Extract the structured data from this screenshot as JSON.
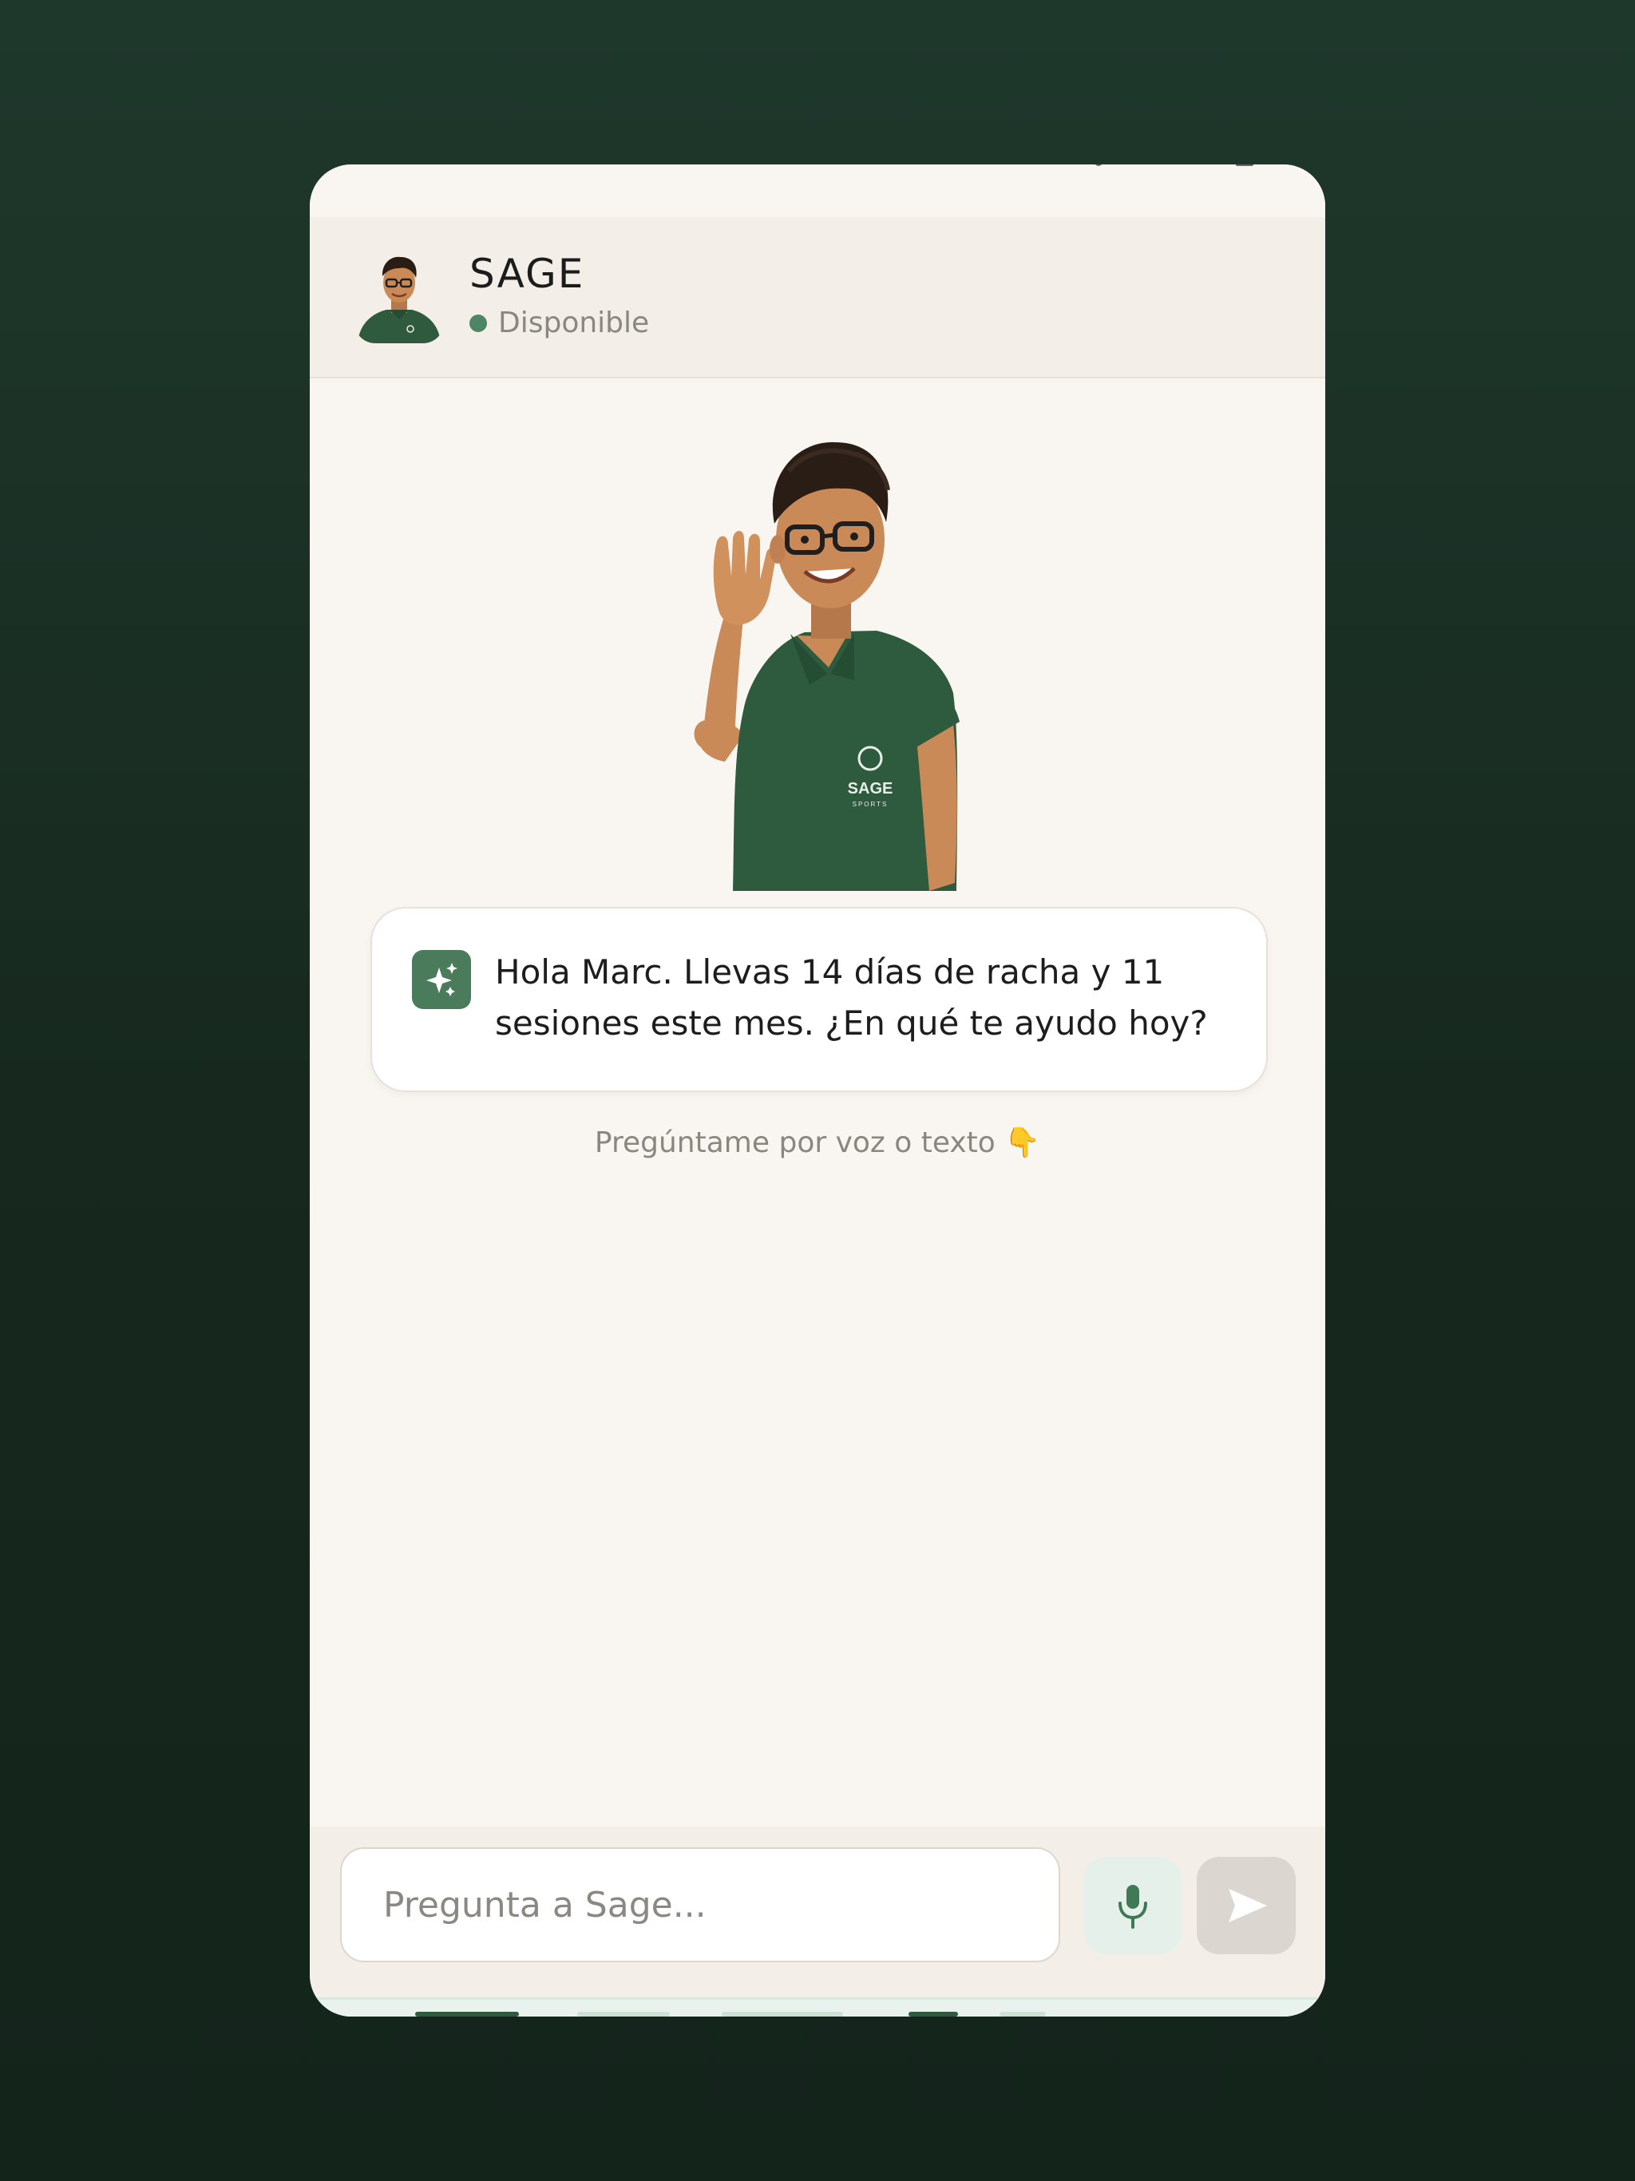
{
  "app": {
    "name": "SAGE",
    "status": "Disponible",
    "status_color": "#4e8663",
    "accent": "#4a7c5b"
  },
  "mascot": {
    "shirt_logo": "SAGE",
    "shirt_logo_sub": "SPORTS"
  },
  "message": {
    "icon": "sparkles-icon",
    "text": "Hola Marc. Llevas 14 días de racha y 11 sesiones este mes. ¿En qué te ayudo hoy?"
  },
  "hint": "Pregúntame por voz o texto 👇",
  "composer": {
    "placeholder": "Pregunta a Sage...",
    "mic_icon": "microphone-icon",
    "send_icon": "send-icon"
  }
}
